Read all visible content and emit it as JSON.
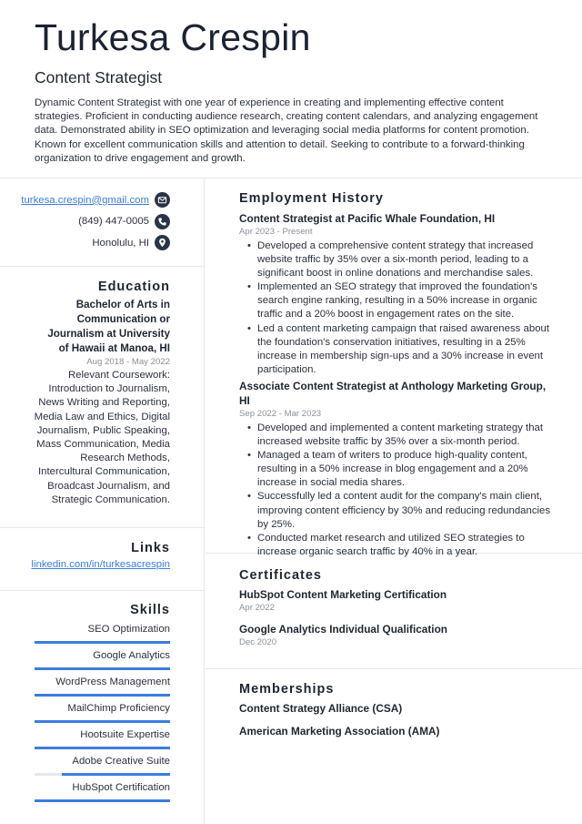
{
  "header": {
    "name": "Turkesa Crespin",
    "title": "Content Strategist",
    "summary": "Dynamic Content Strategist with one year of experience in creating and implementing effective content strategies. Proficient in conducting audience research, creating content calendars, and analyzing engagement data. Demonstrated ability in SEO optimization and leveraging social media platforms for content promotion. Known for excellent communication skills and attention to detail. Seeking to contribute to a forward-thinking organization to drive engagement and growth."
  },
  "contact": {
    "email": "turkesa.crespin@gmail.com",
    "email_icon": "envelope-icon",
    "phone": "(849) 447-0005",
    "phone_icon": "phone-icon",
    "location": "Honolulu, HI",
    "location_icon": "map-pin-icon"
  },
  "education": {
    "heading": "Education",
    "degree": "Bachelor of Arts in Communication or Journalism at University of Hawaii at Manoa, HI",
    "dates": "Aug 2018 - May 2022",
    "description": "Relevant Coursework: Introduction to Journalism, News Writing and Reporting, Media Law and Ethics, Digital Journalism, Public Speaking, Mass Communication, Media Research Methods, Intercultural Communication, Broadcast Journalism, and Strategic Communication."
  },
  "links": {
    "heading": "Links",
    "items": [
      "linkedin.com/in/turkesacrespin"
    ]
  },
  "skills": {
    "heading": "Skills",
    "accent_color": "#3b7ddd",
    "items": [
      {
        "name": "SEO Optimization",
        "level_percent": 100
      },
      {
        "name": "Google Analytics",
        "level_percent": 100
      },
      {
        "name": "WordPress Management",
        "level_percent": 100
      },
      {
        "name": "MailChimp Proficiency",
        "level_percent": 100
      },
      {
        "name": "Hootsuite Expertise",
        "level_percent": 100
      },
      {
        "name": "Adobe Creative Suite",
        "level_percent": 80
      },
      {
        "name": "HubSpot Certification",
        "level_percent": 100
      }
    ]
  },
  "employment": {
    "heading": "Employment History",
    "jobs": [
      {
        "title": "Content Strategist at Pacific Whale Foundation, HI",
        "dates": "Apr 2023 - Present",
        "bullets": [
          "Developed a comprehensive content strategy that increased website traffic by 35% over a six-month period, leading to a significant boost in online donations and merchandise sales.",
          "Implemented an SEO strategy that improved the foundation's search engine ranking, resulting in a 50% increase in organic traffic and a 20% boost in engagement rates on the site.",
          "Led a content marketing campaign that raised awareness about the foundation's conservation initiatives, resulting in a 25% increase in membership sign-ups and a 30% increase in event participation."
        ]
      },
      {
        "title": "Associate Content Strategist at Anthology Marketing Group, HI",
        "dates": "Sep 2022 - Mar 2023",
        "bullets": [
          "Developed and implemented a content marketing strategy that increased website traffic by 35% over a six-month period.",
          "Managed a team of writers to produce high-quality content, resulting in a 50% increase in blog engagement and a 20% increase in social media shares.",
          "Successfully led a content audit for the company's main client, improving content efficiency by 30% and reducing redundancies by 25%.",
          "Conducted market research and utilized SEO strategies to increase organic search traffic by 40% in a year."
        ]
      }
    ]
  },
  "certificates": {
    "heading": "Certificates",
    "items": [
      {
        "name": "HubSpot Content Marketing Certification",
        "date": "Apr 2022"
      },
      {
        "name": "Google Analytics Individual Qualification",
        "date": "Dec 2020"
      }
    ]
  },
  "memberships": {
    "heading": "Memberships",
    "items": [
      "Content Strategy Alliance (CSA)",
      "American Marketing Association (AMA)"
    ]
  }
}
